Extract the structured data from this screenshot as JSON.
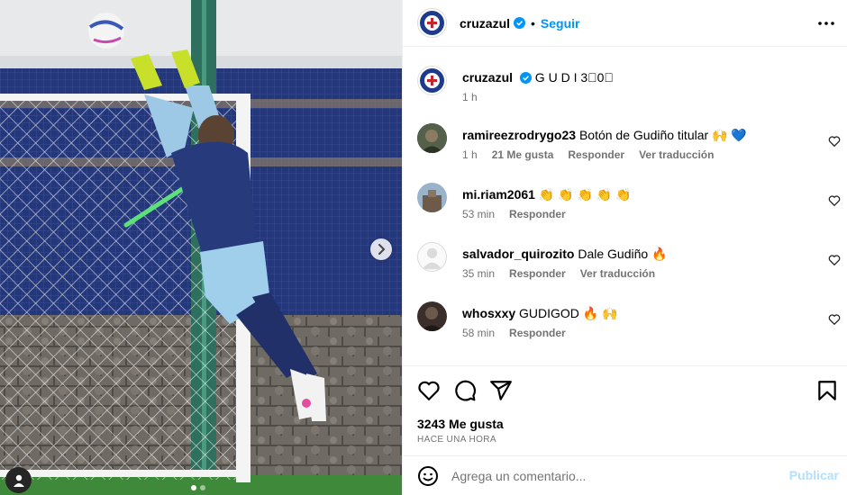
{
  "colors": {
    "accent": "#0095f6",
    "muted": "#737373",
    "cruz_azul_blue": "#1d3b8a",
    "publish_disabled": "#b2dffc"
  },
  "post": {
    "media": {
      "carousel_dots": 2,
      "active_dot": 1,
      "icons": {
        "next": "chevron-right-icon",
        "tagged": "user-icon"
      }
    },
    "header": {
      "username": "cruzazul",
      "separator": "•",
      "follow": "Seguir",
      "more_icon": "more-horizontal-icon"
    },
    "caption": {
      "username": "cruzazul",
      "text": "G U D I 3⃣0⃣",
      "time": "1 h"
    },
    "comments": [
      {
        "username": "ramireezrodrygo23",
        "text": "Botón de Gudiño titular 🙌 💙",
        "time": "1 h",
        "likes": "21 Me gusta",
        "reply": "Responder",
        "translate": "Ver traducción"
      },
      {
        "username": "mi.riam2061",
        "text": "👏 👏 👏 👏 👏",
        "time": "53 min",
        "reply": "Responder"
      },
      {
        "username": "salvador_quirozito",
        "text": "Dale Gudiño 🔥",
        "time": "35 min",
        "reply": "Responder",
        "translate": "Ver traducción"
      },
      {
        "username": "whosxxy",
        "text": "GUDIGOD 🔥 🙌",
        "time": "58 min",
        "reply": "Responder"
      }
    ],
    "actions": {
      "likes": "3243 Me gusta",
      "timestamp": "HACE UNA HORA"
    },
    "composer": {
      "placeholder": "Agrega un comentario...",
      "publish": "Publicar"
    }
  }
}
